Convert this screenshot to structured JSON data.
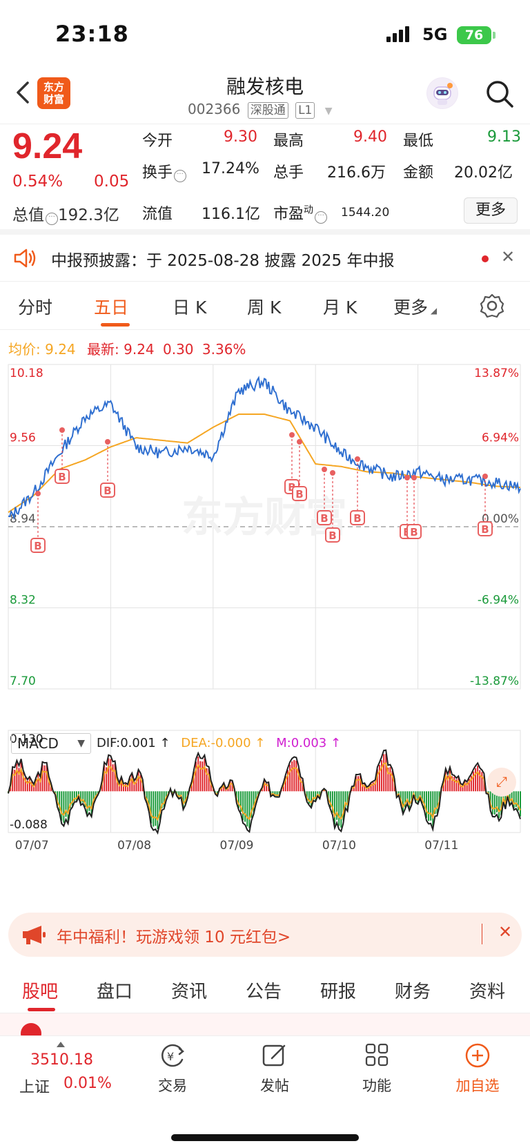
{
  "status_bar": {
    "time": "23:18",
    "network": "5G",
    "battery": "76"
  },
  "header": {
    "logo_text_line1": "东方",
    "logo_text_line2": "财富",
    "stock_name": "融发核电",
    "stock_code": "002366",
    "tag_connect": "深股通",
    "tag_level": "L1"
  },
  "quote": {
    "price": "9.24",
    "change_pct": "0.54%",
    "change": "0.05",
    "open_label": "今开",
    "open": "9.30",
    "high_label": "最高",
    "high": "9.40",
    "low_label": "最低",
    "low": "9.13",
    "turnover_label": "换手",
    "turnover": "17.24%",
    "volume_label": "总手",
    "volume": "216.6万",
    "amount_label": "金额",
    "amount": "20.02亿",
    "mktcap_label": "总值",
    "mktcap": "192.3亿",
    "float_label": "流值",
    "float_cap": "116.1亿",
    "pe_label": "市盈",
    "pe_sup": "动",
    "pe": "1544.20",
    "more_label": "更多"
  },
  "notice": {
    "text": "中报预披露：于 2025-08-28 披露 2025 年中报"
  },
  "tabs": [
    "分时",
    "五日",
    "日 K",
    "周 K",
    "月 K",
    "更多"
  ],
  "active_tab": "五日",
  "avg_line": {
    "avg_label": "均价:",
    "avg_value": "9.24",
    "latest_label": "最新:",
    "latest_value": "9.24",
    "latest_change": "0.30",
    "latest_pct": "3.36%"
  },
  "chart_data": [
    {
      "type": "line",
      "title": "",
      "x": [
        "07/07",
        "07/08",
        "07/09",
        "07/10",
        "07/11"
      ],
      "ylim": [
        7.7,
        10.18
      ],
      "y_ticks_left": [
        "10.18",
        "9.56",
        "8.94",
        "8.32",
        "7.70"
      ],
      "y_ticks_right": [
        "13.87%",
        "6.94%",
        "0.00%",
        "-6.94%",
        "-13.87%"
      ],
      "reference_price": 8.94,
      "series": [
        {
          "values": [
            9.0,
            9.2,
            9.5,
            9.78,
            9.88,
            9.55,
            9.5,
            9.55,
            9.48,
            9.98,
            10.05,
            9.82,
            9.7,
            9.5,
            9.4,
            9.32,
            9.36,
            9.3,
            9.3,
            9.28,
            9.24
          ]
        },
        {
          "values": [
            9.05,
            9.18,
            9.38,
            9.45,
            9.55,
            9.62,
            9.6,
            9.58,
            9.7,
            9.8,
            9.8,
            9.75,
            9.42,
            9.4,
            9.36,
            9.35,
            9.32,
            9.3,
            9.28,
            9.25,
            9.24
          ]
        }
      ],
      "markers": "B"
    },
    {
      "type": "bar",
      "title": "MACD",
      "ylim": [
        -0.088,
        0.13
      ],
      "y_ticks": [
        "0.130",
        "-0.088"
      ]
    }
  ],
  "macd": {
    "selector": "MACD",
    "dif": "DIF:0.001 ↑",
    "dea": "DEA:-0.000 ↑",
    "m": "M:0.003 ↑"
  },
  "colors": {
    "accent": "#f05a1a",
    "up": "#e0262c",
    "down": "#1a9a3a",
    "price_line": "#2f6fd0",
    "avg_line": "#f5a623"
  },
  "promo": {
    "text": "年中福利！玩游戏领 10 元红包>"
  },
  "bottom_tabs": [
    "股吧",
    "盘口",
    "资讯",
    "公告",
    "研报",
    "财务",
    "资料"
  ],
  "footer": {
    "index_value": "3510.18",
    "index_name": "上证",
    "index_pct": "0.01%",
    "buttons": [
      "交易",
      "发帖",
      "功能",
      "加自选"
    ]
  }
}
